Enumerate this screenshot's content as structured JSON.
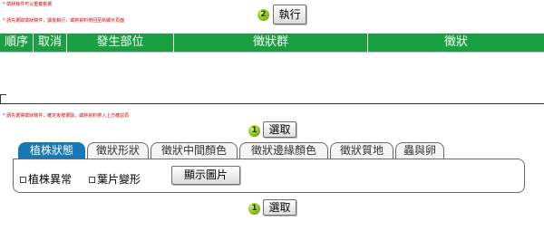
{
  "notes": {
    "line1": "* 徵狀條件可以重複挑選",
    "line2": "* 請先選取徵狀條件，讓後執行，或將資料帶回至新顯示頁面",
    "line3": "* 請先選擇徵狀條件，確定後按選取，或將資料帶入上方確認頁"
  },
  "execute": {
    "step": "2",
    "label": "執行"
  },
  "results_table": {
    "headers": [
      "順序",
      "取消",
      "發生部位",
      "徵狀群",
      "徵狀"
    ]
  },
  "select_top": {
    "step": "1",
    "label": "選取"
  },
  "tabs": [
    {
      "label": "植株狀態",
      "active": true
    },
    {
      "label": "徵狀形狀",
      "active": false
    },
    {
      "label": "徵狀中間顏色",
      "active": false
    },
    {
      "label": "徵狀邊緣顏色",
      "active": false
    },
    {
      "label": "徵狀質地",
      "active": false
    },
    {
      "label": "蟲與卵",
      "active": false
    }
  ],
  "options": [
    {
      "label": "植株異常",
      "checked": false
    },
    {
      "label": "葉片變形",
      "checked": false
    }
  ],
  "show_image_button": "顯示圖片",
  "select_bottom": {
    "step": "1",
    "label": "選取"
  },
  "colors": {
    "header_green": "#1aa043",
    "tab_active": "#1778b8",
    "note_red": "#cc0000"
  }
}
